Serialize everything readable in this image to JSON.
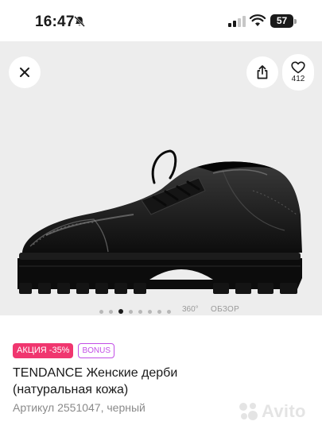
{
  "status_bar": {
    "time": "16:47",
    "battery": "57",
    "icons": [
      "bell-slash-icon",
      "cellular-signal-icon",
      "wifi-icon",
      "battery-icon"
    ]
  },
  "gallery": {
    "favorites_count": "412",
    "dots_total": 8,
    "active_dot": 2,
    "view_360_label": "360°",
    "overview_label": "ОБЗОР",
    "icons": [
      "close-icon",
      "share-icon",
      "heart-icon",
      "camera-icon"
    ]
  },
  "product": {
    "sale_badge": "АКЦИЯ -35%",
    "bonus_badge": "BONUS",
    "title": "TENDANCE Женские дерби (натуральная кожа)",
    "article": "Артикул 2551047, черный"
  },
  "watermark": {
    "brand": "Avito"
  },
  "colors": {
    "sale": "#f0366f",
    "bonus": "#c24ee6",
    "gallery_bg": "#ededed",
    "camera": "#e2226f"
  }
}
